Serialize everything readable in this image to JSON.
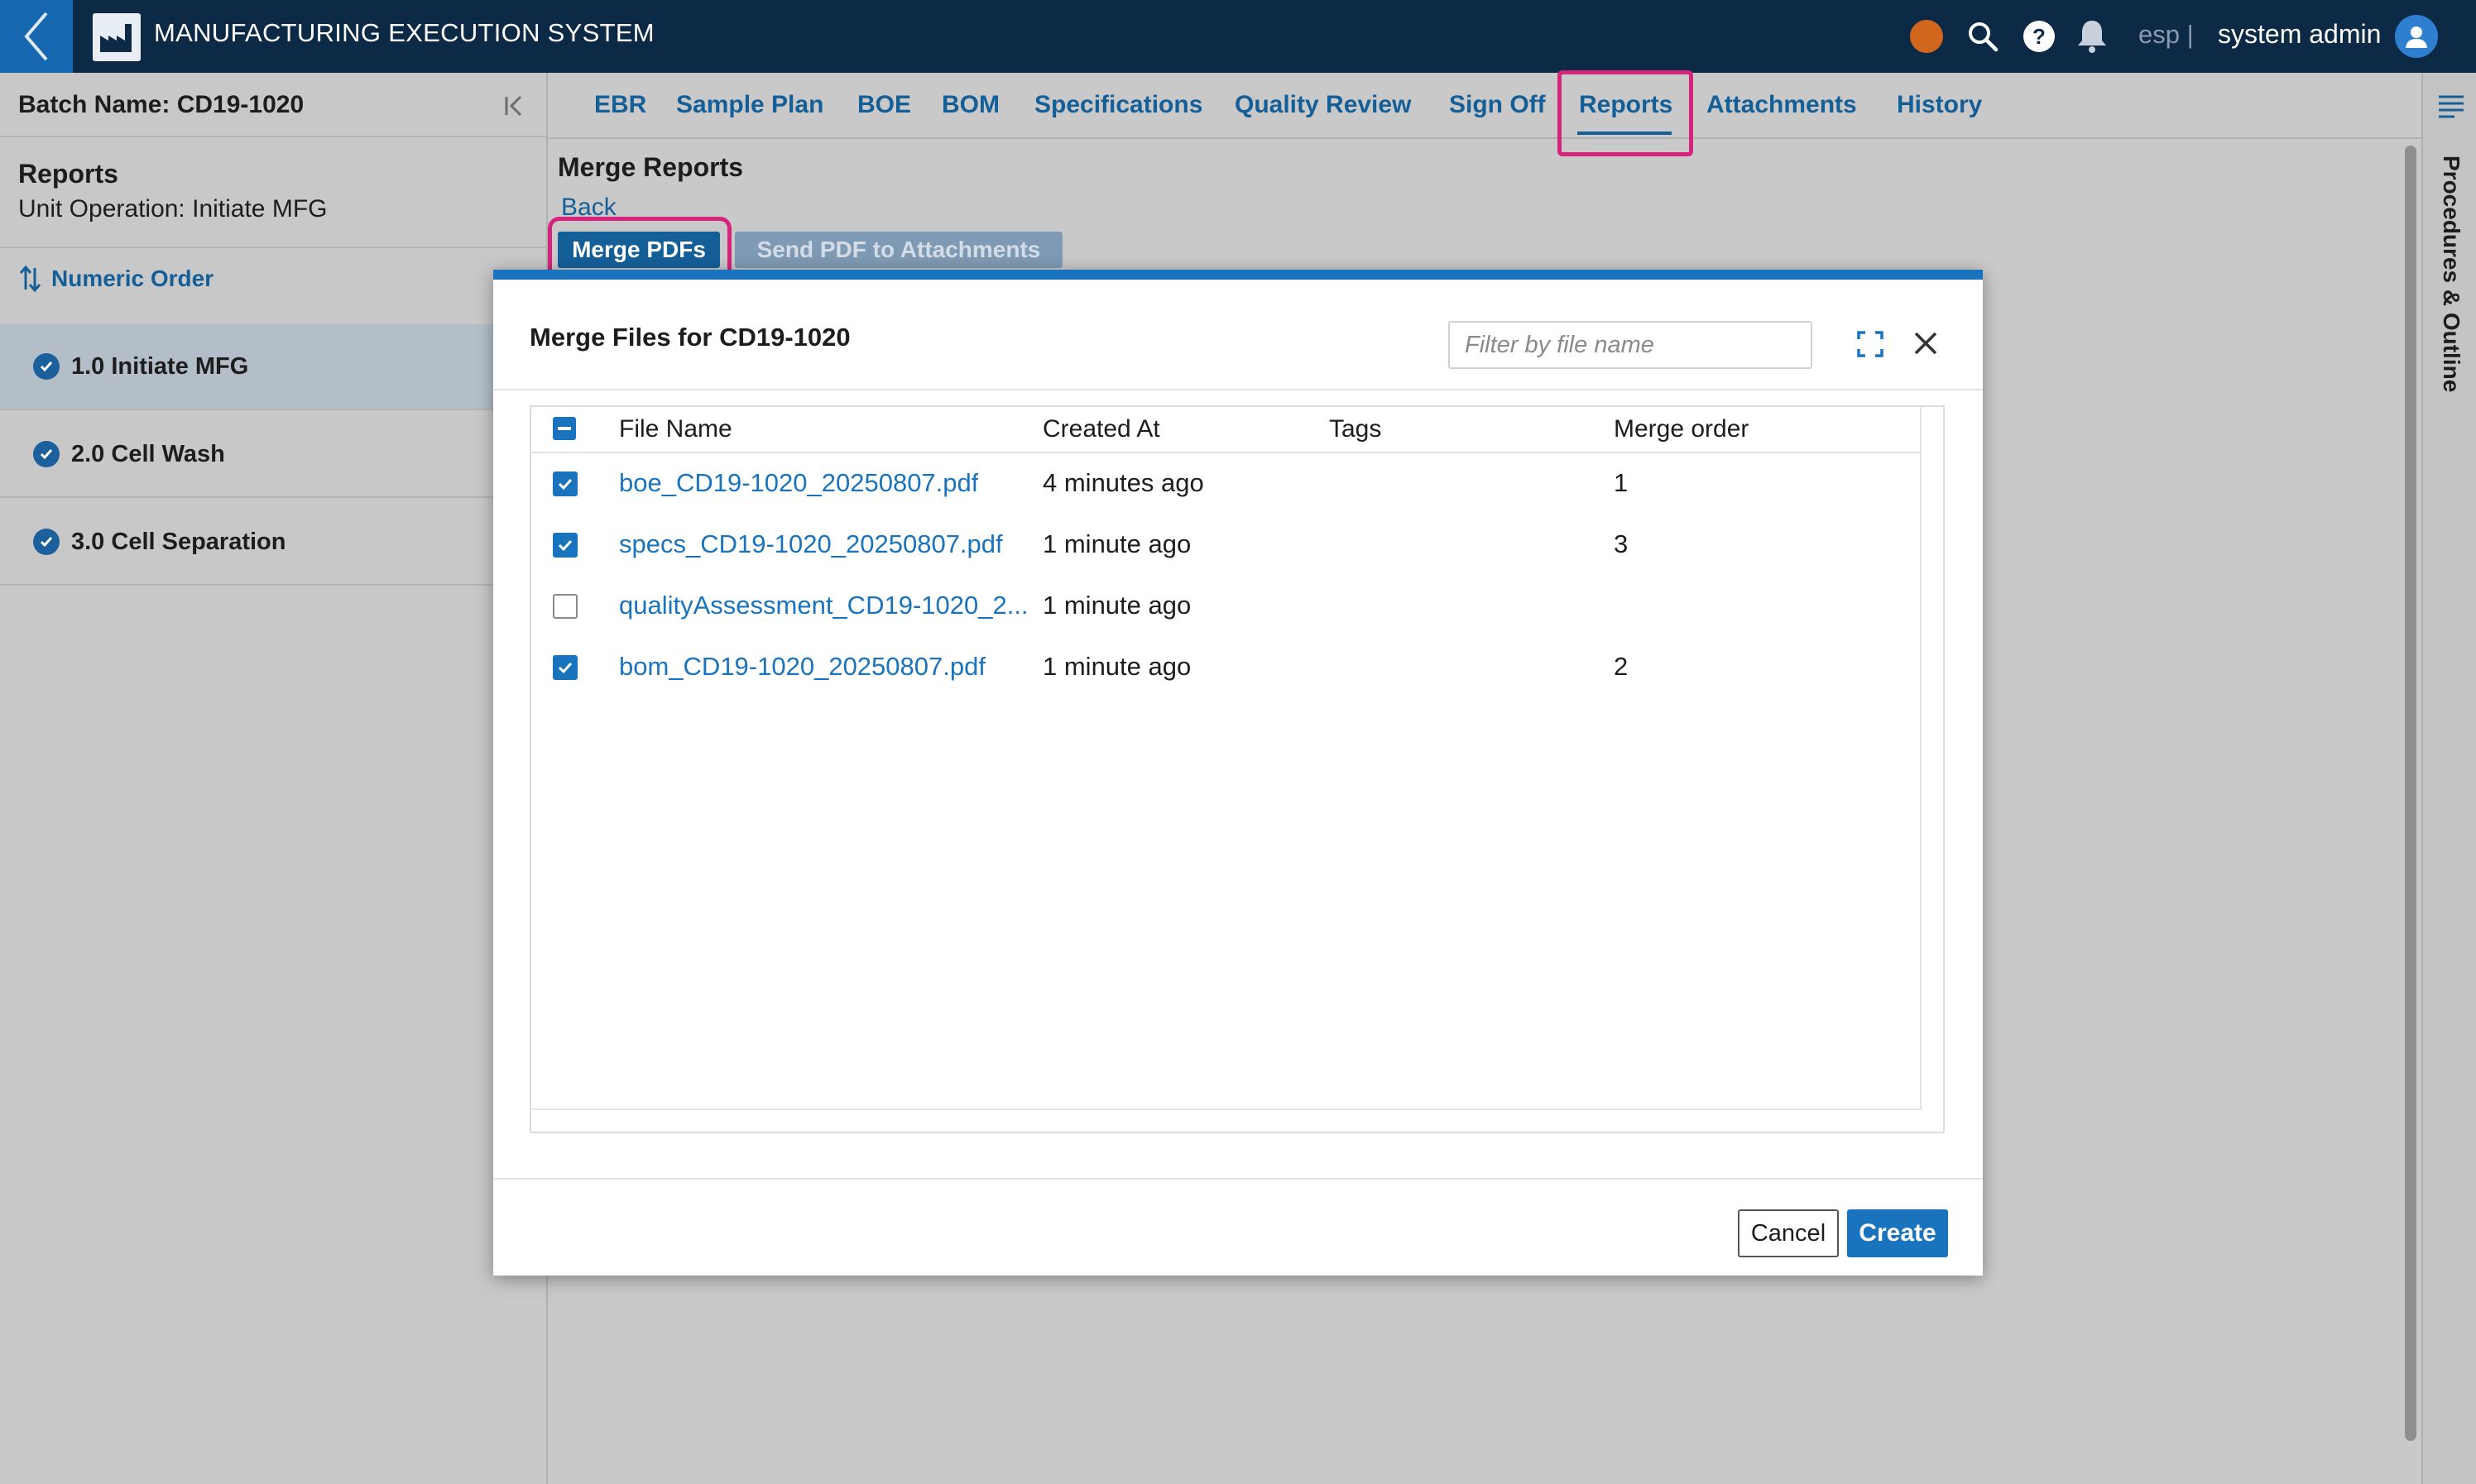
{
  "header": {
    "app_title": "MANUFACTURING EXECUTION SYSTEM",
    "lang": "esp |",
    "user_name": "system admin",
    "icons": [
      "back-chevron-icon",
      "factory-logo-icon",
      "status-dot-icon",
      "search-icon",
      "help-icon",
      "bell-icon",
      "user-avatar-icon"
    ],
    "status_color": "#d1671d"
  },
  "sidebar": {
    "batch_name": "Batch Name: CD19-1020",
    "section_title": "Reports",
    "unit_operation": "Unit Operation: Initiate MFG",
    "sort_label": "Numeric Order",
    "operations": [
      {
        "label": "1.0 Initiate MFG",
        "active": true
      },
      {
        "label": "2.0 Cell Wash",
        "active": false
      },
      {
        "label": "3.0 Cell Separation",
        "active": false
      }
    ]
  },
  "tabs": [
    {
      "label": "EBR"
    },
    {
      "label": "Sample Plan"
    },
    {
      "label": "BOE"
    },
    {
      "label": "BOM"
    },
    {
      "label": "Specifications"
    },
    {
      "label": "Quality Review"
    },
    {
      "label": "Sign Off"
    },
    {
      "label": "Reports",
      "active": true
    },
    {
      "label": "Attachments"
    },
    {
      "label": "History"
    }
  ],
  "main": {
    "title": "Merge Reports",
    "back_label": "Back",
    "merge_button": "Merge PDFs",
    "send_button": "Send PDF to Attachments"
  },
  "right_rail": {
    "label": "Procedures & Outline"
  },
  "modal": {
    "title": "Merge Files for CD19-1020",
    "filter_placeholder": "Filter by file name",
    "columns": [
      "File Name",
      "Created At",
      "Tags",
      "Merge order"
    ],
    "rows": [
      {
        "file_name": "boe_CD19-1020_20250807.pdf",
        "created_at": "4 minutes ago",
        "tags": "",
        "merge_order": "1",
        "checked": true
      },
      {
        "file_name": "specs_CD19-1020_20250807.pdf",
        "created_at": "1 minute ago",
        "tags": "",
        "merge_order": "3",
        "checked": true
      },
      {
        "file_name": "qualityAssessment_CD19-1020_2...",
        "created_at": "1 minute ago",
        "tags": "",
        "merge_order": "",
        "checked": false
      },
      {
        "file_name": "bom_CD19-1020_20250807.pdf",
        "created_at": "1 minute ago",
        "tags": "",
        "merge_order": "2",
        "checked": true
      }
    ],
    "cancel_label": "Cancel",
    "create_label": "Create"
  },
  "colors": {
    "topbar": "#0c2a46",
    "accent": "#1a73bd",
    "highlight": "#d6237e"
  }
}
